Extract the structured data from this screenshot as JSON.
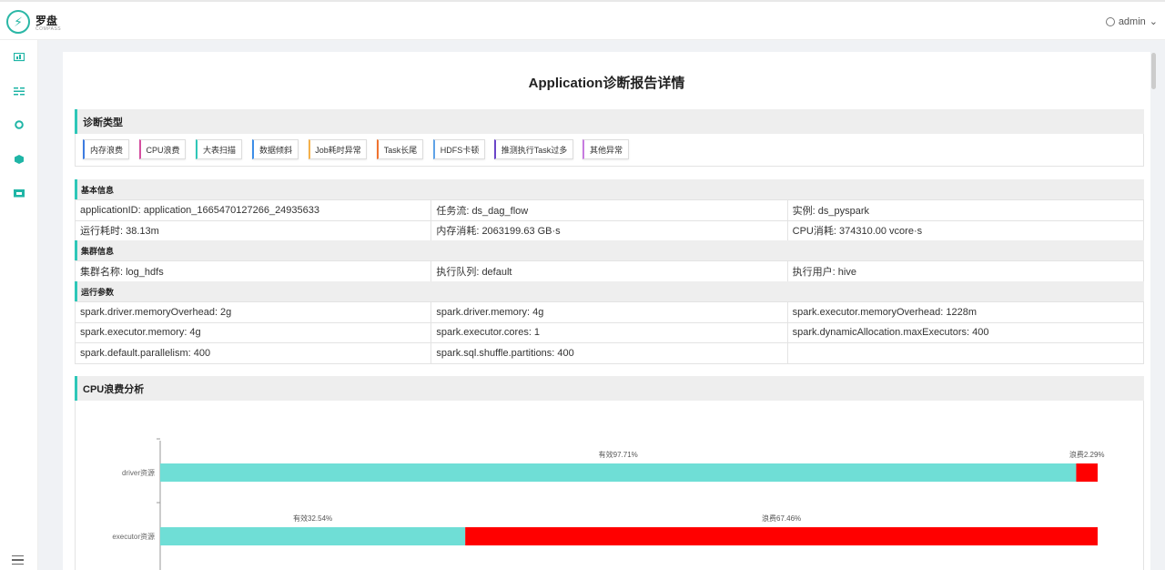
{
  "app": {
    "logo_text": "罗盘",
    "logo_sub": "COMPASS",
    "user": "admin"
  },
  "page": {
    "title": "Application诊断报告详情"
  },
  "diagnosis": {
    "header": "诊断类型",
    "tags": [
      {
        "label": "内存浪费",
        "color": "#3d7be0"
      },
      {
        "label": "CPU浪费",
        "color": "#d64fa0"
      },
      {
        "label": "大表扫描",
        "color": "#2ec7b8"
      },
      {
        "label": "数据倾斜",
        "color": "#3d8ee8"
      },
      {
        "label": "Job耗时异常",
        "color": "#f5b14a"
      },
      {
        "label": "Task长尾",
        "color": "#f07330"
      },
      {
        "label": "HDFS卡顿",
        "color": "#5fa3e8"
      },
      {
        "label": "推测执行Task过多",
        "color": "#6b46c9"
      },
      {
        "label": "其他异常",
        "color": "#c77be0"
      }
    ]
  },
  "basic": {
    "header": "基本信息",
    "rows": [
      [
        "applicationID:  application_1665470127266_24935633",
        "任务流:  ds_dag_flow",
        "实例:  ds_pyspark"
      ],
      [
        "运行耗时:  38.13m",
        "内存消耗:  2063199.63 GB·s",
        "CPU消耗:  374310.00 vcore·s"
      ]
    ]
  },
  "cluster": {
    "header": "集群信息",
    "rows": [
      [
        "集群名称:  log_hdfs",
        "执行队列:  default",
        "执行用户:  hive"
      ]
    ]
  },
  "params": {
    "header": "运行参数",
    "rows": [
      [
        "spark.driver.memoryOverhead:  2g",
        "spark.driver.memory:  4g",
        "spark.executor.memoryOverhead:  1228m"
      ],
      [
        "spark.executor.memory:  4g",
        "spark.executor.cores:  1",
        "spark.dynamicAllocation.maxExecutors:  400"
      ],
      [
        "spark.default.parallelism:  400",
        "spark.sql.shuffle.partitions:  400",
        ""
      ]
    ]
  },
  "cpu": {
    "header": "CPU浪费分析"
  },
  "chart_data": {
    "type": "bar",
    "orientation": "horizontal",
    "stacked": true,
    "categories": [
      "driver资源",
      "executor资源"
    ],
    "series": [
      {
        "name": "有效",
        "color": "#6fded6",
        "values": [
          97.71,
          32.54
        ],
        "labels": [
          "有效97.71%",
          "有效32.54%"
        ]
      },
      {
        "name": "浪费",
        "color": "#ff0000",
        "values": [
          2.29,
          67.46
        ],
        "labels": [
          "浪费2.29%",
          "浪费67.46%"
        ]
      }
    ],
    "xlim": [
      0,
      100
    ]
  }
}
